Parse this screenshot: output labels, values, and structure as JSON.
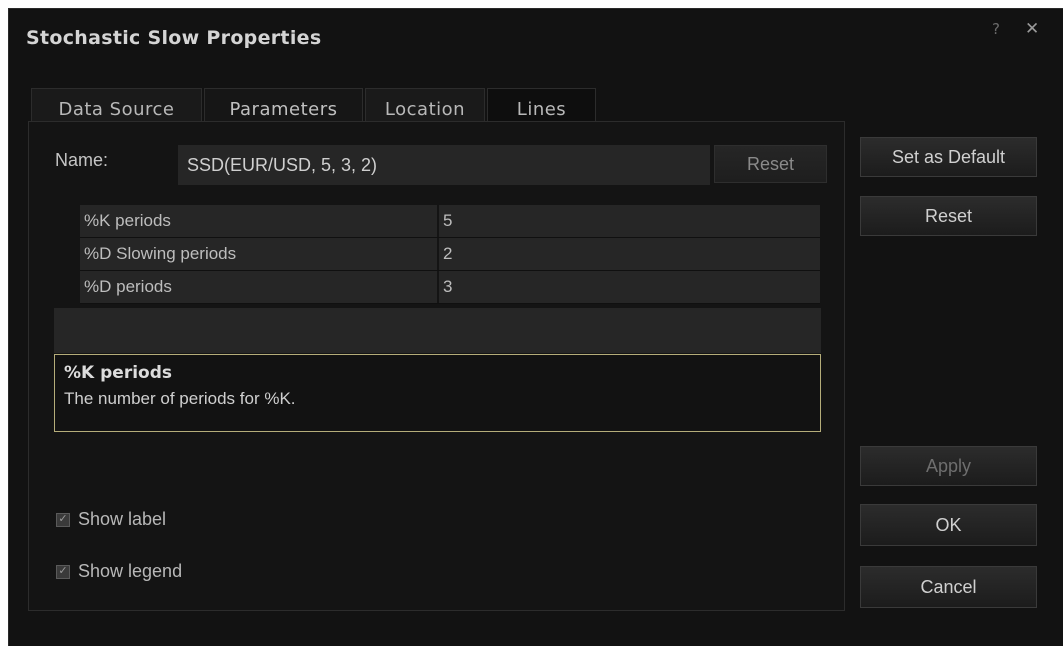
{
  "dialog": {
    "title": "Stochastic Slow Properties",
    "help_label": "?",
    "close_label": "✕"
  },
  "tabs": [
    {
      "label": "Data Source"
    },
    {
      "label": "Parameters"
    },
    {
      "label": "Location"
    },
    {
      "label": "Lines"
    }
  ],
  "active_tab": "Parameters",
  "name_field": {
    "label": "Name:",
    "value": "SSD(EUR/USD, 5, 3, 2)",
    "reset_label": "Reset"
  },
  "parameters": [
    {
      "name": "%K periods",
      "value": "5"
    },
    {
      "name": "%D Slowing periods",
      "value": "2"
    },
    {
      "name": "%D periods",
      "value": "3"
    }
  ],
  "description": {
    "title": "%K periods",
    "text": "The number of periods for %K."
  },
  "options": {
    "show_label": {
      "label": "Show label",
      "checked": true
    },
    "show_legend": {
      "label": "Show legend",
      "checked": true
    }
  },
  "buttons": {
    "set_default": "Set as Default",
    "reset": "Reset",
    "apply": "Apply",
    "ok": "OK",
    "cancel": "Cancel"
  },
  "colors": {
    "background": "#121212",
    "field": "#262626",
    "description_border": "#b5ad7a"
  }
}
